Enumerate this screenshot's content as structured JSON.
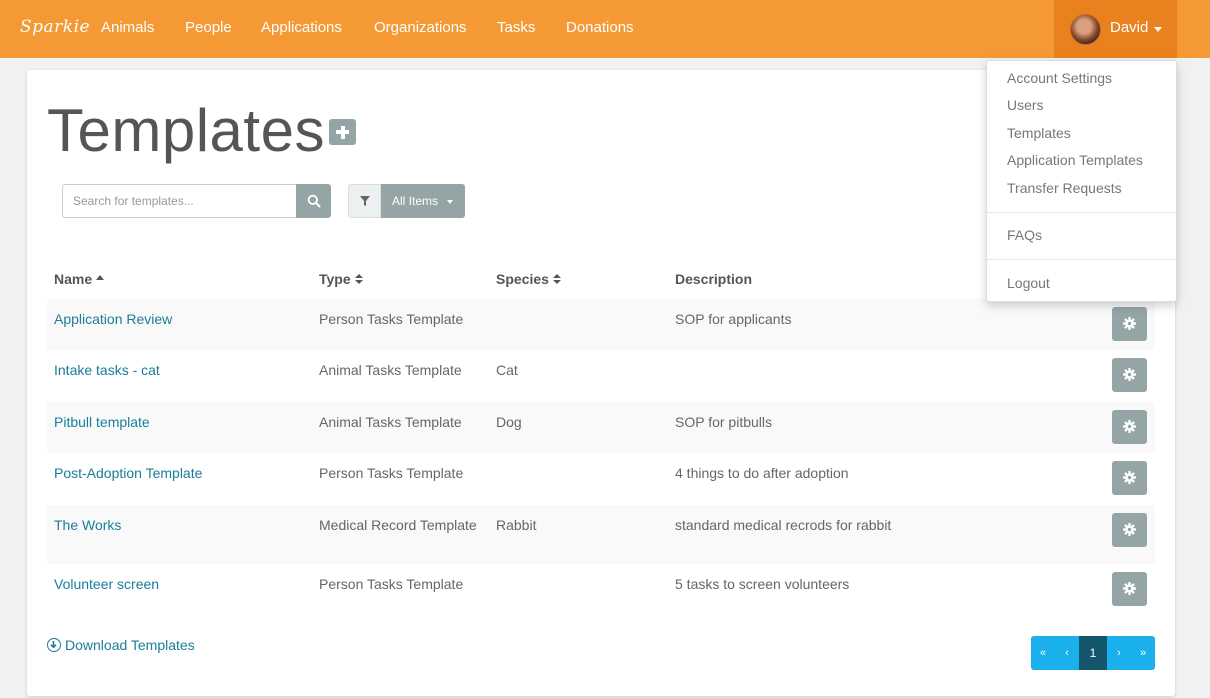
{
  "app": {
    "brand": "Sparkie"
  },
  "nav": {
    "items": [
      "Animals",
      "People",
      "Applications",
      "Organizations",
      "Tasks",
      "Donations"
    ],
    "user": "David"
  },
  "user_menu": {
    "items": [
      "Account Settings",
      "Users",
      "Templates",
      "Application Templates",
      "Transfer Requests",
      "FAQs",
      "Logout"
    ]
  },
  "page": {
    "title": "Templates"
  },
  "search": {
    "placeholder": "Search for templates..."
  },
  "filter": {
    "selected": "All Items"
  },
  "table": {
    "columns": [
      "Name",
      "Type",
      "Species",
      "Description"
    ],
    "rows": [
      {
        "name": "Application Review",
        "type": "Person Tasks Template",
        "species": "",
        "description": "SOP for applicants"
      },
      {
        "name": "Intake tasks - cat",
        "type": "Animal Tasks Template",
        "species": "Cat",
        "description": ""
      },
      {
        "name": "Pitbull template",
        "type": "Animal Tasks Template",
        "species": "Dog",
        "description": "SOP for pitbulls"
      },
      {
        "name": "Post-Adoption Template",
        "type": "Person Tasks Template",
        "species": "",
        "description": "4 things to do after adoption"
      },
      {
        "name": "The Works",
        "type": "Medical Record Template",
        "species": "Rabbit",
        "description": "standard medical recrods for rabbit"
      },
      {
        "name": "Volunteer screen",
        "type": "Person Tasks Template",
        "species": "",
        "description": "5 tasks to screen volunteers"
      }
    ]
  },
  "footer": {
    "download_label": "Download Templates"
  },
  "pagination": {
    "first": "«",
    "prev": "‹",
    "current": "1",
    "next": "›",
    "last": "»"
  },
  "colors": {
    "navbar": "#f59935",
    "user_menu_active": "#e8811e",
    "link": "#1a7d9a",
    "button_gray": "#95a5a6",
    "pager": "#1ab0ec",
    "pager_active": "#13566d"
  },
  "icons": {
    "search": "search-icon",
    "filter": "filter-icon",
    "add": "plus-icon",
    "row_action": "gear-icon",
    "download": "download-circle-icon"
  }
}
